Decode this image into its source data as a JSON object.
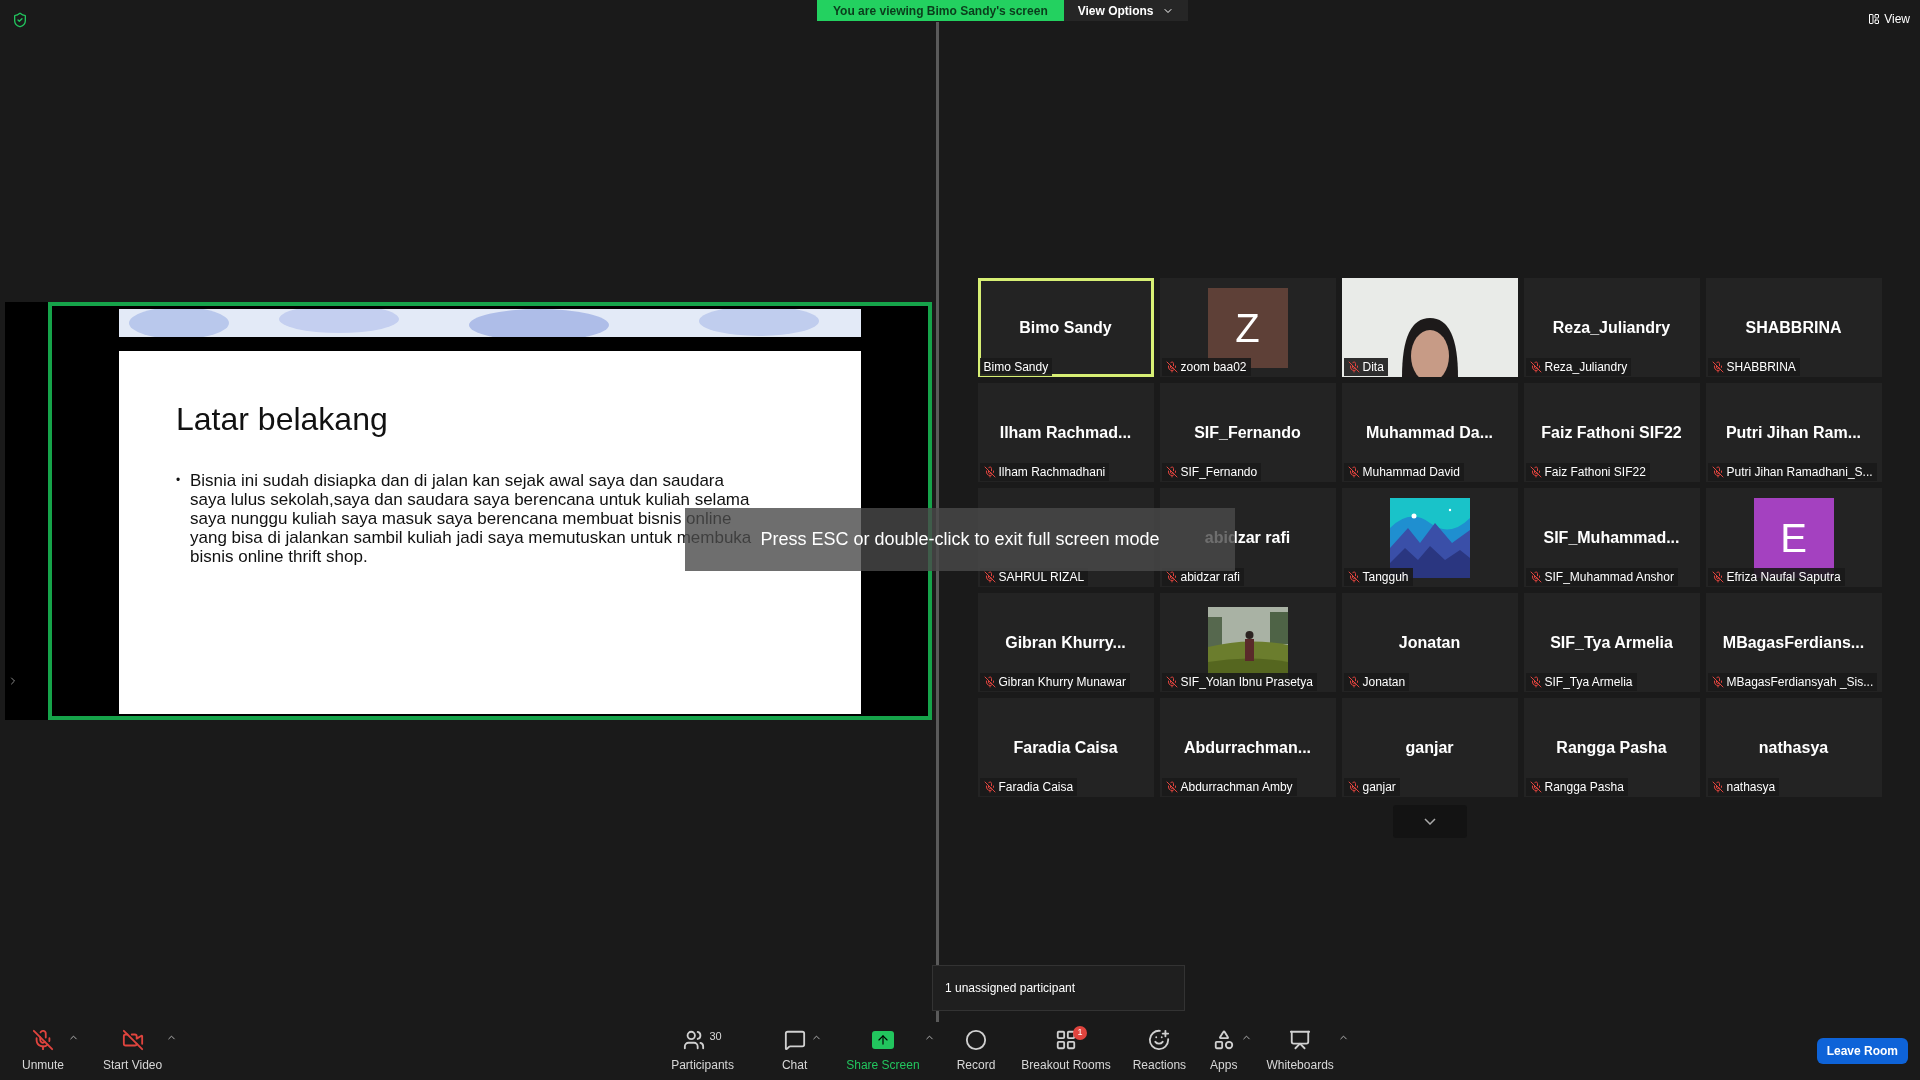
{
  "top_bar": {
    "viewing_banner": "You are viewing Bimo Sandy's screen",
    "view_options": "View Options",
    "view_button": "View"
  },
  "shared_slide": {
    "title": "Latar belakang",
    "bullet": "•",
    "lines": [
      "Bisnia ini sudah disiapka  dan di jalan kan sejak awal saya dan saudara",
      "saya lulus sekolah,saya dan saudara saya berencana untuk kuliah selama",
      "saya nunggu kuliah saya masuk saya berencana membuat bisnis online",
      "yang bisa di jalankan sambil kuliah jadi saya memutuskan untuk membuka",
      "bisnis online thrift shop."
    ]
  },
  "fullscreen_hint": "Press ESC or double-click to exit full screen mode",
  "tiles": [
    {
      "kind": "name",
      "title": "Bimo Sandy",
      "name": "Bimo Sandy",
      "muted": false,
      "speaking": true
    },
    {
      "kind": "avatar",
      "letter": "Z",
      "color": "#5e4037",
      "name": "zoom baa02",
      "muted": true,
      "speaking": false
    },
    {
      "kind": "video",
      "name": "Dita",
      "muted": true,
      "speaking": false
    },
    {
      "kind": "name",
      "title": "Reza_Juliandry",
      "name": "Reza_Juliandry",
      "muted": true,
      "speaking": false
    },
    {
      "kind": "name",
      "title": "SHABBRINA",
      "name": "SHABBRINA",
      "muted": true,
      "speaking": false
    },
    {
      "kind": "name",
      "title": "Ilham  Rachmad...",
      "name": "Ilham Rachmadhani",
      "muted": true,
      "speaking": false
    },
    {
      "kind": "name",
      "title": "SIF_Fernando",
      "name": "SIF_Fernando",
      "muted": true,
      "speaking": false
    },
    {
      "kind": "name",
      "title": "Muhammad  Da...",
      "name": "Muhammad David",
      "muted": true,
      "speaking": false
    },
    {
      "kind": "name",
      "title": "Faiz Fathoni SIF22",
      "name": "Faiz Fathoni SIF22",
      "muted": true,
      "speaking": false
    },
    {
      "kind": "name",
      "title": "Putri  Jihan  Ram...",
      "name": "Putri Jihan Ramadhani_S...",
      "muted": true,
      "speaking": false
    },
    {
      "kind": "blank",
      "name": "SAHRUL RIZAL",
      "muted": true,
      "speaking": false
    },
    {
      "kind": "name",
      "title": "abidzar rafi",
      "name": "abidzar rafi",
      "muted": true,
      "speaking": false
    },
    {
      "kind": "illustration",
      "name": "Tangguh",
      "muted": true,
      "speaking": false
    },
    {
      "kind": "name",
      "title": "SIF_Muhammad...",
      "name": "SIF_Muhammad Anshor",
      "muted": true,
      "speaking": false
    },
    {
      "kind": "avatar",
      "letter": "E",
      "color": "#a441c0",
      "name": "Efriza Naufal Saputra",
      "muted": true,
      "speaking": false
    },
    {
      "kind": "name",
      "title": "Gibran  Khurry...",
      "name": "Gibran Khurry Munawar",
      "muted": true,
      "speaking": false
    },
    {
      "name": "SIF_Yolan Ibnu Prasetya",
      "muted": true,
      "speaking": false
    },
    {
      "kind": "name",
      "title": "Jonatan",
      "name": "Jonatan",
      "muted": true,
      "speaking": false
    },
    {
      "kind": "name",
      "title": "SIF_Tya Armelia",
      "name": "SIF_Tya Armelia",
      "muted": true,
      "speaking": false
    },
    {
      "kind": "name",
      "title": "MBagasFerdians...",
      "name": "MBagasFerdiansyah _Sis...",
      "muted": true,
      "speaking": false
    },
    {
      "kind": "name",
      "title": "Faradia Caisa",
      "name": "Faradia Caisa",
      "muted": true,
      "speaking": false
    },
    {
      "kind": "name",
      "title": "Abdurrachman...",
      "name": "Abdurrachman Amby",
      "muted": true,
      "speaking": false
    },
    {
      "kind": "name",
      "title": "ganjar",
      "name": "ganjar",
      "muted": true,
      "speaking": false
    },
    {
      "kind": "name",
      "title": "Rangga Pasha",
      "name": "Rangga Pasha",
      "muted": true,
      "speaking": false
    },
    {
      "kind": "name",
      "title": "nathasya",
      "name": "nathasya",
      "muted": true,
      "speaking": false
    }
  ],
  "breakout_tooltip": "1 unassigned participant",
  "toolbar": [
    {
      "kind": "unmute",
      "label": "Unmute",
      "caret": true
    },
    {
      "kind": "video",
      "label": "Start Video",
      "caret": true
    },
    {
      "kind": "participants",
      "label": "Participants",
      "count": "30",
      "caret": false
    },
    {
      "kind": "chat",
      "label": "Chat",
      "caret": true
    },
    {
      "kind": "share",
      "label": "Share Screen",
      "caret": true
    },
    {
      "kind": "record",
      "label": "Record",
      "caret": false
    },
    {
      "kind": "breakout",
      "label": "Breakout Rooms",
      "badge": "1",
      "caret": false
    },
    {
      "kind": "reactions",
      "label": "Reactions",
      "caret": false
    },
    {
      "kind": "apps",
      "label": "Apps",
      "caret": true
    },
    {
      "kind": "whiteboards",
      "label": "Whiteboards",
      "caret": true
    }
  ],
  "leave_button": "Leave Room"
}
